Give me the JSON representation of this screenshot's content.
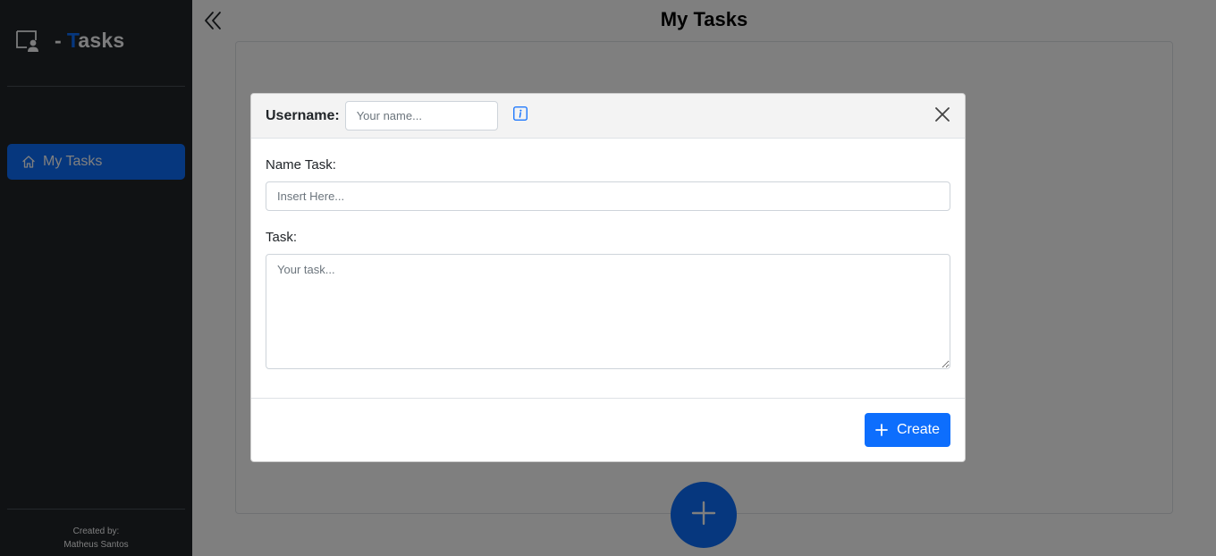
{
  "sidebar": {
    "brand": {
      "dash": "-",
      "first_letter": "T",
      "rest": "asks",
      "icon": "presentation-user-icon"
    },
    "nav_items": [
      {
        "label": "My Tasks",
        "icon": "house-icon",
        "active": true
      }
    ],
    "credits": {
      "line1": "Created by:",
      "line2": "Matheus Santos"
    }
  },
  "header": {
    "title": "My Tasks",
    "collapse_icon": "chevron-double-left-icon"
  },
  "fab": {
    "icon": "plus-icon"
  },
  "modal": {
    "username_label": "Username:",
    "username_placeholder": "Your name...",
    "username_value": "",
    "info_icon": "info-square-icon",
    "close_icon": "close-icon",
    "name_task_label": "Name Task:",
    "name_task_placeholder": "Insert Here...",
    "name_task_value": "",
    "task_label": "Task:",
    "task_placeholder": "Your task...",
    "task_value": "",
    "create_label": "Create",
    "create_icon": "plus-icon"
  },
  "colors": {
    "primary": "#0d6efd",
    "sidebar_bg": "#212529",
    "backdrop": "rgba(0,0,0,0.5)"
  }
}
